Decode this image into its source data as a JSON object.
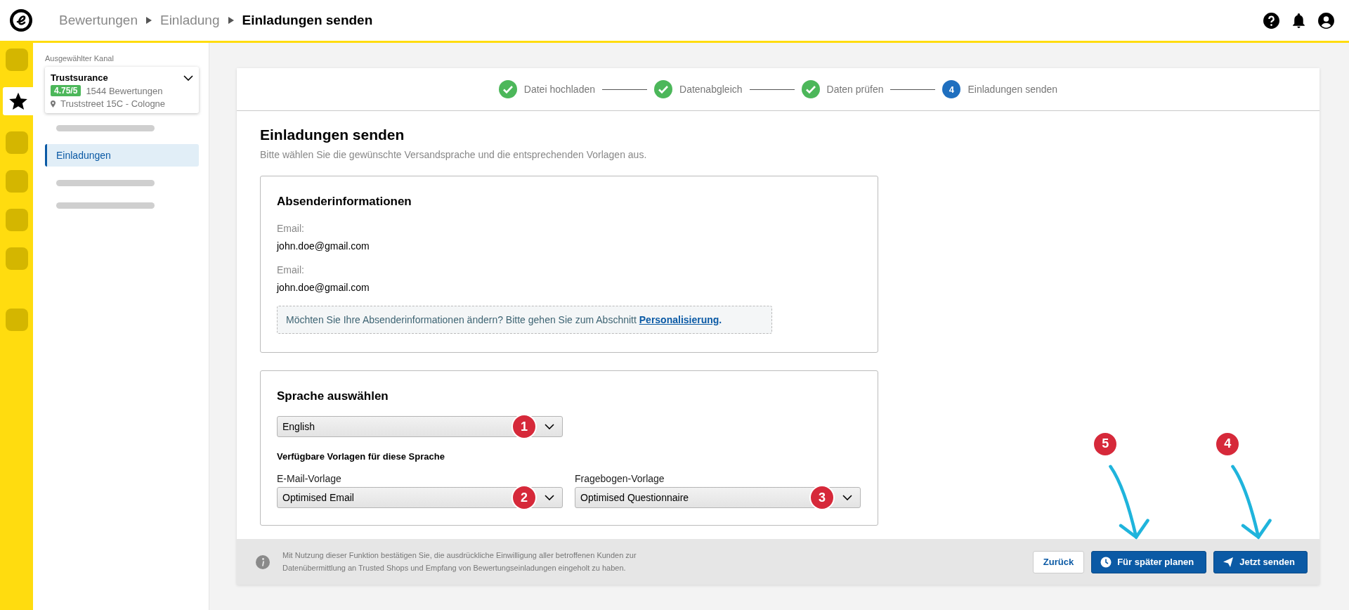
{
  "breadcrumb": [
    {
      "label": "Bewertungen",
      "current": false
    },
    {
      "label": "Einladung",
      "current": false
    },
    {
      "label": "Einladungen senden",
      "current": true
    }
  ],
  "rail": [
    {
      "kind": "placeholder",
      "selected": false
    },
    {
      "kind": "star",
      "selected": true
    },
    {
      "kind": "placeholder",
      "selected": false
    },
    {
      "kind": "placeholder",
      "selected": false
    },
    {
      "kind": "placeholder",
      "selected": false
    },
    {
      "kind": "placeholder",
      "selected": false
    },
    {
      "kind": "placeholder",
      "selected": false
    }
  ],
  "sidebar": {
    "channel_label": "Ausgewählter Kanal",
    "channel": {
      "name": "Trustsurance",
      "rating": "4.75/5",
      "reviews": "1544 Bewertungen",
      "address": "Truststreet 15C - Cologne"
    },
    "items": [
      {
        "kind": "placeholder",
        "selected": false
      },
      {
        "kind": "link",
        "label": "Einladungen",
        "selected": true
      },
      {
        "kind": "placeholder",
        "selected": false
      },
      {
        "kind": "placeholder",
        "selected": false
      }
    ]
  },
  "stepper": [
    {
      "label": "Datei hochladen",
      "completed": true
    },
    {
      "label": "Datenabgleich",
      "completed": true
    },
    {
      "label": "Daten prüfen",
      "completed": true
    },
    {
      "label": "Einladungen senden",
      "completed": false,
      "number": "4"
    }
  ],
  "title": "Einladungen senden",
  "subtitle": "Bitte wählen Sie die gewünschte Versandsprache und die entsprechenden Vorlagen aus.",
  "sender": {
    "heading": "Absenderinformationen",
    "fields": [
      {
        "label": "Email:",
        "value": "john.doe@gmail.com"
      },
      {
        "label": "Email:",
        "value": "john.doe@gmail.com"
      }
    ],
    "notice": "Möchten Sie Ihre Absenderinformationen ändern? Bitte gehen Sie zum Abschnitt ",
    "notice_link": "Personalisierung",
    "notice_end": "."
  },
  "language": {
    "heading": "Sprache auswählen",
    "select": {
      "value": "English",
      "badge": "1"
    },
    "templates_heading": "Verfügbare Vorlagen für diese Sprache",
    "templates": [
      {
        "label": "E-Mail-Vorlage",
        "value": "Optimised Email",
        "badge": "2"
      },
      {
        "label": "Fragebogen-Vorlage",
        "value": "Optimised Questionnaire",
        "badge": "3"
      }
    ]
  },
  "footer": {
    "consent": "Mit Nutzung dieser Funktion bestätigen Sie, die ausdrückliche Einwilligung aller betroffenen Kunden zur Datenübermittlung an Trusted Shops und Empfang von Bewertungseinladungen eingeholt zu haben.",
    "buttons": [
      {
        "kind": "secondary",
        "label": "Zurück"
      },
      {
        "kind": "schedule",
        "label": "Für später planen",
        "badge": "5"
      },
      {
        "kind": "send",
        "label": "Jetzt senden",
        "badge": "4"
      }
    ]
  }
}
